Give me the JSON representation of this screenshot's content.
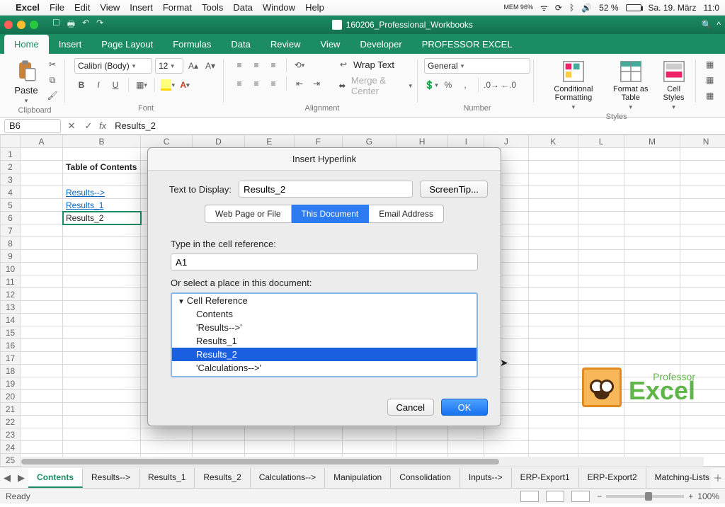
{
  "mac_menu": {
    "app": "Excel",
    "items": [
      "File",
      "Edit",
      "View",
      "Insert",
      "Format",
      "Tools",
      "Data",
      "Window",
      "Help"
    ],
    "mem": "MEM 96%",
    "battery": "52 %",
    "date": "Sa. 19. März",
    "time": "11:0"
  },
  "window_title": "160206_Professional_Workbooks",
  "ribbon_tabs": [
    "Home",
    "Insert",
    "Page Layout",
    "Formulas",
    "Data",
    "Review",
    "View",
    "Developer",
    "PROFESSOR EXCEL"
  ],
  "active_tab": 0,
  "groups": {
    "clipboard": "Clipboard",
    "font": "Font",
    "align": "Alignment",
    "number": "Number",
    "styles": "Styles"
  },
  "paste_label": "Paste",
  "font_name": "Calibri (Body)",
  "font_size": "12",
  "number_format": "General",
  "wrap_label": "Wrap Text",
  "merge_label": "Merge & Center",
  "cond_label": "Conditional Formatting",
  "fat_label": "Format as Table",
  "cstyle_label": "Cell Styles",
  "name_box": "B6",
  "formula": "Results_2",
  "columns": [
    "A",
    "B",
    "C",
    "D",
    "E",
    "F",
    "G",
    "H",
    "I",
    "J",
    "K",
    "L",
    "M",
    "N"
  ],
  "row_count": 25,
  "cells": {
    "B2": {
      "t": "Table of Contents",
      "cls": "bold"
    },
    "B4": {
      "t": "Results-->",
      "cls": "link"
    },
    "B5": {
      "t": "Results_1",
      "cls": "link"
    },
    "B6": {
      "t": "Results_2",
      "cls": "selcell"
    }
  },
  "dialog": {
    "title": "Insert Hyperlink",
    "text_label": "Text to Display:",
    "text_value": "Results_2",
    "screentip": "ScreenTip...",
    "tabs": [
      "Web Page or File",
      "This Document",
      "Email Address"
    ],
    "active_tab": 1,
    "cellref_label": "Type in the cell reference:",
    "cellref": "A1",
    "select_label": "Or select a place in this document:",
    "tree_root": "Cell Reference",
    "tree": [
      "Contents",
      "'Results-->'",
      "Results_1",
      "Results_2",
      "'Calculations-->'"
    ],
    "selected": 3,
    "cancel": "Cancel",
    "ok": "OK"
  },
  "sheets": [
    "Contents",
    "Results-->",
    "Results_1",
    "Results_2",
    "Calculations-->",
    "Manipulation",
    "Consolidation",
    "Inputs-->",
    "ERP-Export1",
    "ERP-Export2",
    "Matching-Lists"
  ],
  "active_sheet": 0,
  "status": "Ready",
  "zoom": "100%",
  "logo": {
    "top": "Professor",
    "main": "Excel"
  }
}
